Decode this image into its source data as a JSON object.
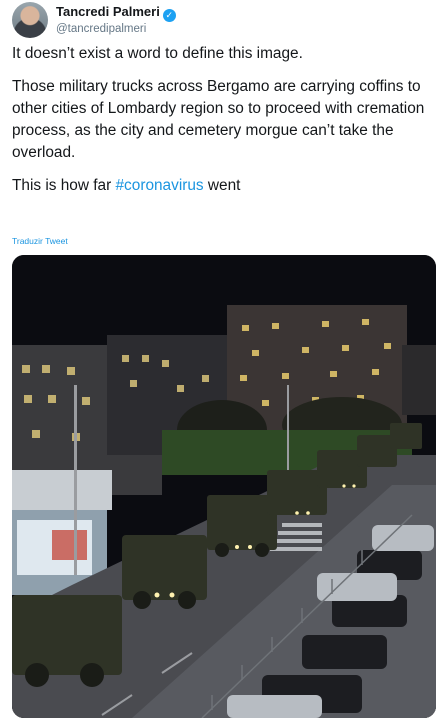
{
  "author": {
    "name": "Tancredi Palmeri",
    "handle": "@tancredipalmeri",
    "verified_icon": "verified-badge-icon"
  },
  "tweet": {
    "line1": "It doesn’t exist a word to define this image.",
    "paragraph2": "Those military trucks across Bergamo are carrying coffins to other cities of Lombardy region so to proceed with cremation process, as the city and cemetery morgue can’t take the overload.",
    "line3_before": "This is how far ",
    "hashtag": "#coronavirus",
    "line3_after": " went"
  },
  "translate_label": "Traduzir Tweet",
  "colors": {
    "accent": "#1b95e0",
    "text": "#14171a",
    "muted": "#657786"
  }
}
